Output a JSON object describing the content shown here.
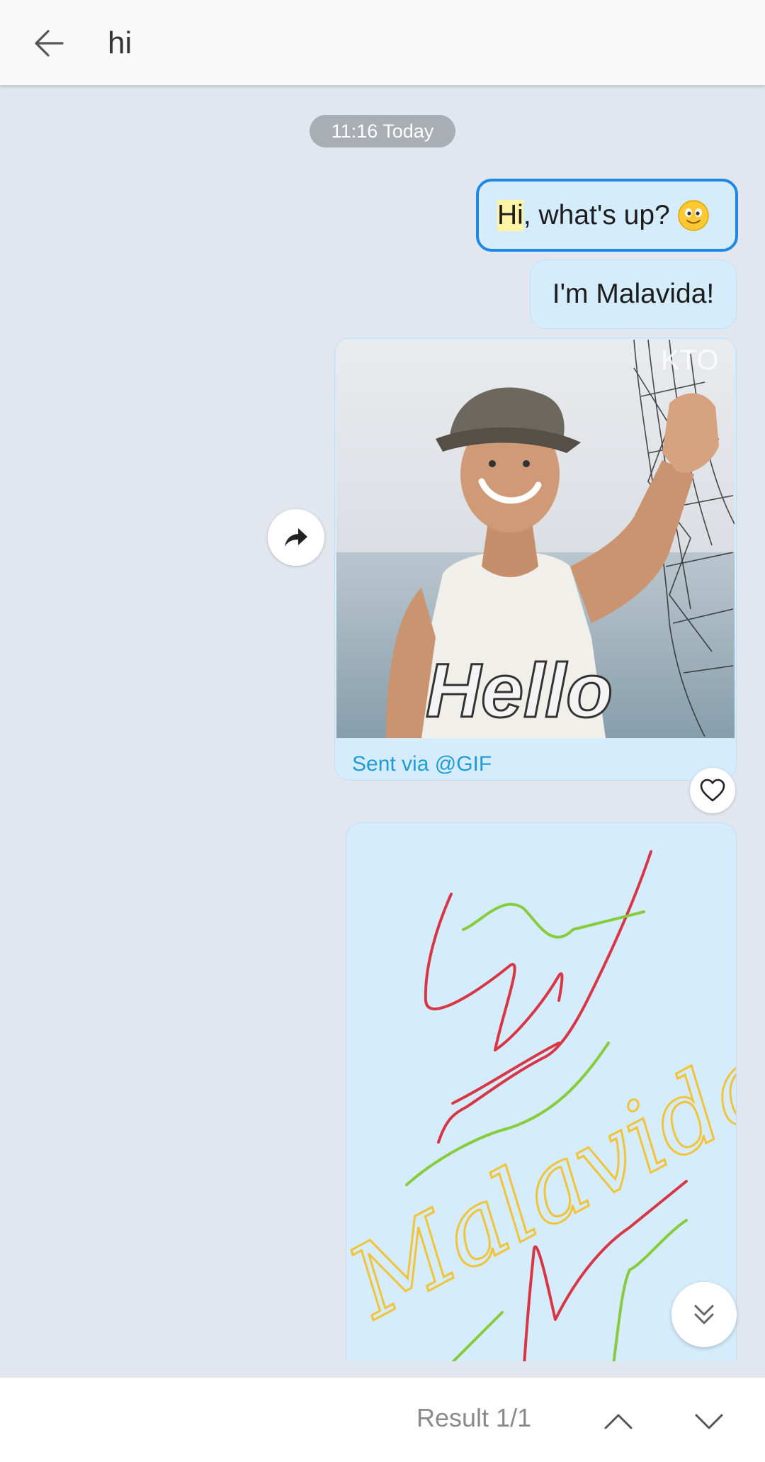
{
  "search": {
    "query": "hi"
  },
  "chat": {
    "date_label": "11:16 Today",
    "messages": [
      {
        "highlight": "Hi",
        "rest": ", what's up?",
        "emoji": "smiling-face"
      },
      {
        "text": "I'm Malavida!"
      }
    ],
    "gif": {
      "watermark": "KTO",
      "overlay_text": "Hello",
      "caption": "Sent via @GIF"
    },
    "drawing": {
      "text": "Malavida"
    }
  },
  "result_bar": {
    "label": "Result 1/1"
  },
  "icons": {
    "back": "arrow-left-icon",
    "forward": "share-arrow-icon",
    "like": "heart-icon",
    "scroll": "double-chevron-down-icon",
    "prev": "chevron-up-icon",
    "next": "chevron-down-icon"
  },
  "colors": {
    "accent": "#1e88e5",
    "bubble": "#d4ecfb",
    "highlight": "#fff3a6",
    "caption": "#1f9bd6",
    "background": "#e2e7ef"
  }
}
